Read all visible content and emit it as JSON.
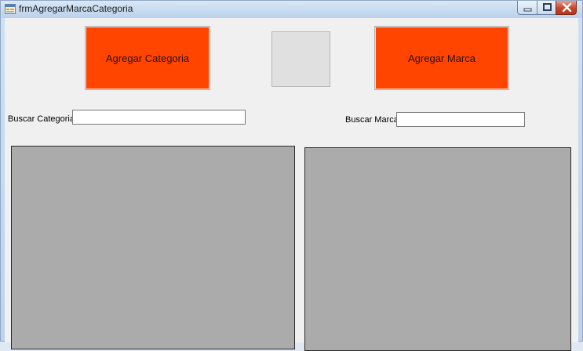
{
  "window": {
    "title": "frmAgregarMarcaCategoria"
  },
  "buttons": {
    "agregar_categoria": "Agregar Categoria",
    "agregar_marca": "Agregar Marca"
  },
  "search": {
    "categoria_label": "Buscar Categoria",
    "categoria_value": "",
    "marca_label": "Buscar Marca",
    "marca_value": ""
  },
  "colors": {
    "button_bg": "#ff4500",
    "grid_bg": "#ababab",
    "form_bg": "#f0f0f0"
  },
  "icons": {
    "app": "form-icon",
    "minimize": "minimize-icon",
    "maximize": "maximize-icon",
    "close": "close-icon"
  }
}
